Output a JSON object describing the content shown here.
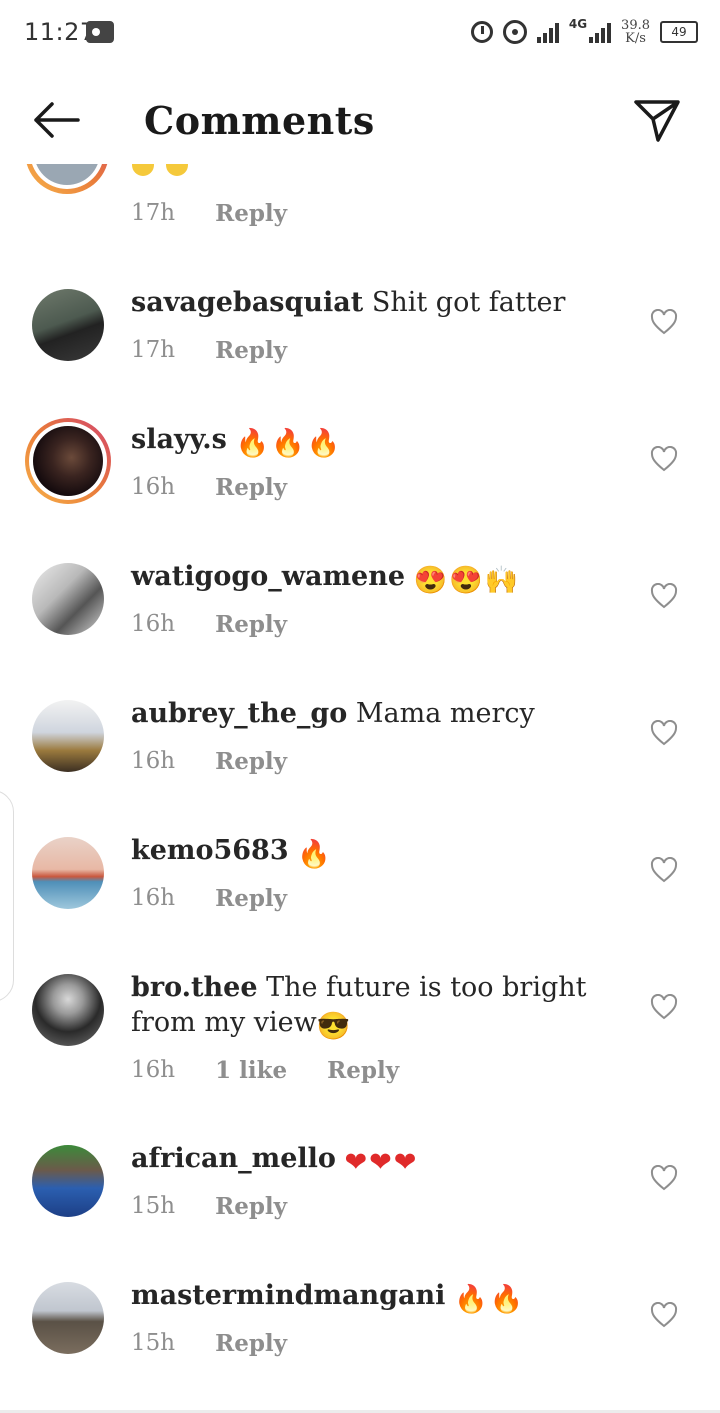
{
  "status_bar": {
    "time": "11:27",
    "network": "4G",
    "speed_value": "39.8",
    "speed_unit": "K/s",
    "battery": "49"
  },
  "header": {
    "title": "Comments",
    "back_icon": "back-arrow-icon",
    "send_icon": "send-icon"
  },
  "partial_comment": {
    "time": "17h",
    "reply": "Reply"
  },
  "comments": [
    {
      "username": "savagebasquiat",
      "text": " Shit got fatter",
      "emojis": [],
      "time": "17h",
      "likes": "",
      "reply": "Reply",
      "story_ring": false
    },
    {
      "username": "slayy.s",
      "text": " ",
      "emojis": [
        "fire",
        "fire",
        "fire"
      ],
      "time": "16h",
      "likes": "",
      "reply": "Reply",
      "story_ring": true
    },
    {
      "username": "watigogo_wamene",
      "text": " ",
      "emojis": [
        "heart-eyes",
        "heart-eyes",
        "raised-hands"
      ],
      "time": "16h",
      "likes": "",
      "reply": "Reply",
      "story_ring": false
    },
    {
      "username": "aubrey_the_go",
      "text": " Mama mercy",
      "emojis": [],
      "time": "16h",
      "likes": "",
      "reply": "Reply",
      "story_ring": false
    },
    {
      "username": "kemo5683",
      "text": " ",
      "emojis": [
        "fire"
      ],
      "time": "16h",
      "likes": "",
      "reply": "Reply",
      "story_ring": false
    },
    {
      "username": "bro.thee",
      "text": " The future is too bright from my view",
      "emojis": [
        "sunglasses"
      ],
      "time": "16h",
      "likes": "1 like",
      "reply": "Reply",
      "story_ring": false
    },
    {
      "username": "african_mello",
      "text": " ",
      "emojis": [
        "red-heart",
        "red-heart",
        "red-heart"
      ],
      "time": "15h",
      "likes": "",
      "reply": "Reply",
      "story_ring": false
    },
    {
      "username": "mastermindmangani",
      "text": " ",
      "emojis": [
        "fire",
        "fire"
      ],
      "time": "15h",
      "likes": "",
      "reply": "Reply",
      "story_ring": false
    }
  ],
  "colors": {
    "text": "#262626",
    "muted": "#8e8e8e",
    "story_ring": "#e97c3a"
  }
}
